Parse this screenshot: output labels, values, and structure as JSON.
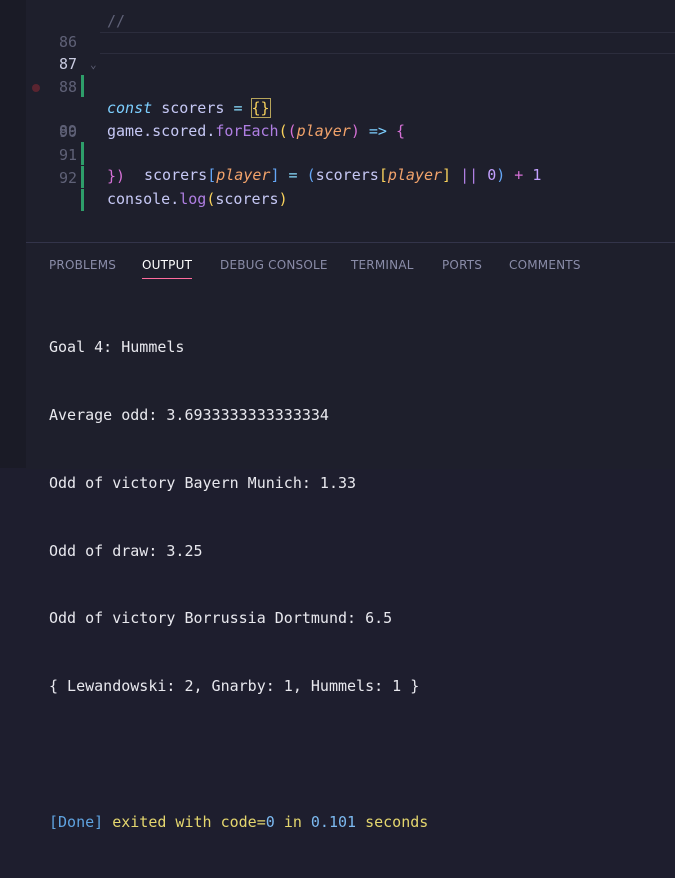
{
  "editor": {
    "top_partial": "//",
    "lines": [
      {
        "no": "86",
        "active": false
      },
      {
        "no": "87",
        "active": true
      },
      {
        "no": "88",
        "active": false
      },
      {
        "no": "89",
        "active": false
      },
      {
        "no": "90",
        "active": false
      },
      {
        "no": "91",
        "active": false
      },
      {
        "no": "92",
        "active": false
      }
    ],
    "line87": {
      "kw": "const",
      "name": "scorers",
      "eq": "=",
      "obj": "{}"
    },
    "line88": {
      "obj": "game",
      "prop": "scored",
      "method": "forEach",
      "param": "player",
      "arrow": "=>",
      "open": "{"
    },
    "line89": {
      "target": "scorers",
      "param": "player",
      "eq": "=",
      "source": "scorers",
      "or": "||",
      "zero": "0",
      "plus": "+",
      "one": "1"
    },
    "line90": {
      "close": "})"
    },
    "line91": {
      "obj": "console",
      "method": "log",
      "arg": "scorers"
    }
  },
  "panel": {
    "tabs": [
      {
        "label": "PROBLEMS"
      },
      {
        "label": "OUTPUT"
      },
      {
        "label": "DEBUG CONSOLE"
      },
      {
        "label": "TERMINAL"
      },
      {
        "label": "PORTS"
      },
      {
        "label": "COMMENTS"
      }
    ],
    "active_tab": "OUTPUT",
    "output_lines": [
      "Goal 4: Hummels",
      "Average odd: 3.6933333333333334",
      "Odd of victory Bayern Munich: 1.33",
      "Odd of draw: 3.25",
      "Odd of victory Borrussia Dortmund: 6.5",
      "{ Lewandowski: 2, Gnarby: 1, Hummels: 1 }",
      ""
    ],
    "done": {
      "tag": "[Done]",
      "msg1": "exited with",
      "code_key": "code=",
      "code_val": "0",
      "msg2": "in",
      "time": "0.101",
      "msg3": "seconds"
    }
  },
  "colors": {
    "accent_tab_underline": "#ff6b9d",
    "background": "#1e1f2c",
    "gutter_modified": "#2e9e6a"
  }
}
